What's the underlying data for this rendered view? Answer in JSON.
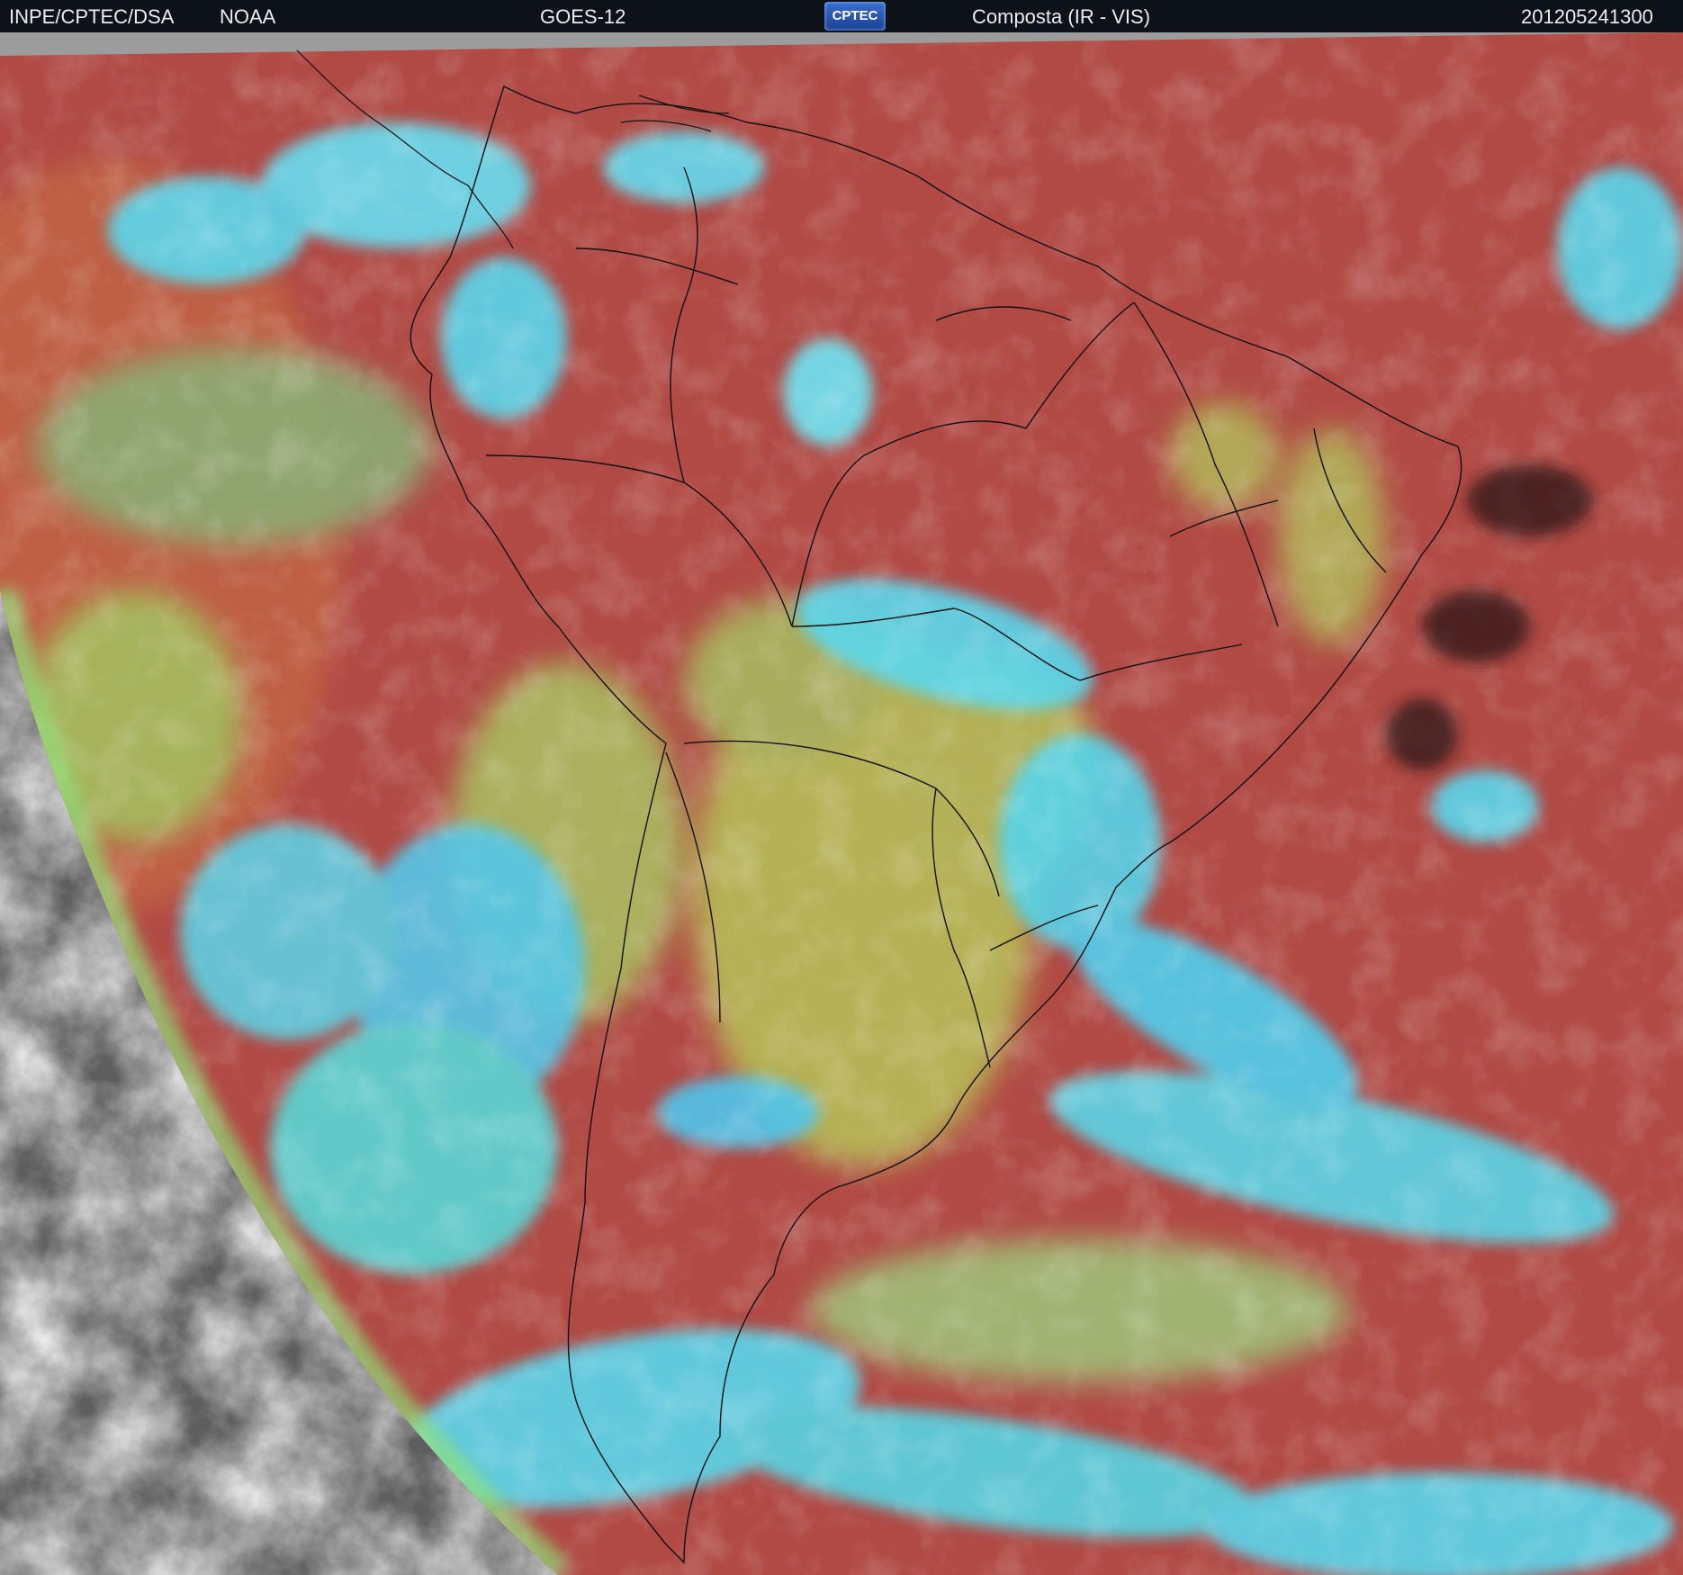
{
  "header": {
    "institution": "INPE/CPTEC/DSA",
    "agency": "NOAA",
    "satellite": "GOES-12",
    "logo_text": "CPTEC",
    "product": "Composta (IR - VIS)",
    "timestamp": "201205241300"
  },
  "colors": {
    "header_bg": "#0d1218",
    "header_text": "#e8edf2",
    "space_gray": "#9c9c9c",
    "ocean_clear": "#b54a45",
    "land_clear": "#a94644",
    "low_cloud": "#b8c85a",
    "mid_cloud": "#6fd6a8",
    "high_cloud": "#5ad8ee",
    "grayscale_region": "#6a6a6a",
    "border_line": "#111111"
  }
}
